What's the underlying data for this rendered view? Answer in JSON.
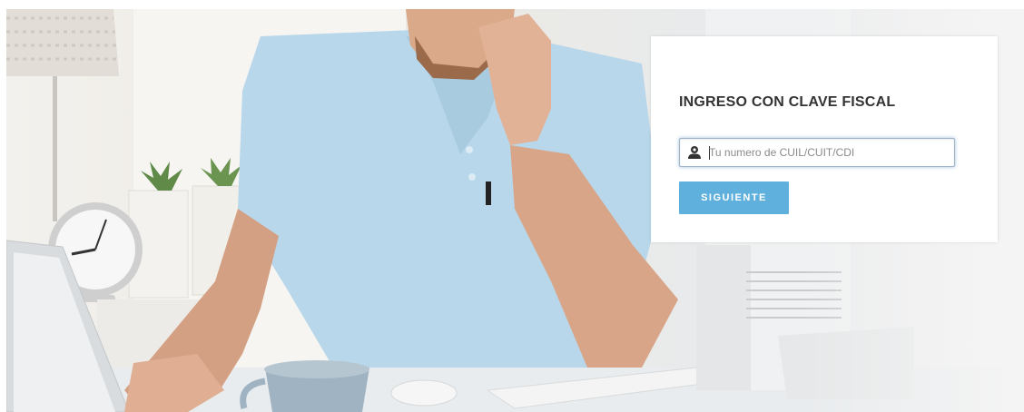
{
  "login": {
    "title": "INGRESO CON CLAVE FISCAL",
    "input_placeholder": "Tu numero de CUIL/CUIT/CDI",
    "input_value": "",
    "submit_label": "SIGUIENTE"
  },
  "icons": {
    "input_prefix": "user-icon"
  },
  "colors": {
    "button_bg": "#5fb0dc",
    "title_text": "#333333",
    "card_bg": "#ffffff"
  }
}
